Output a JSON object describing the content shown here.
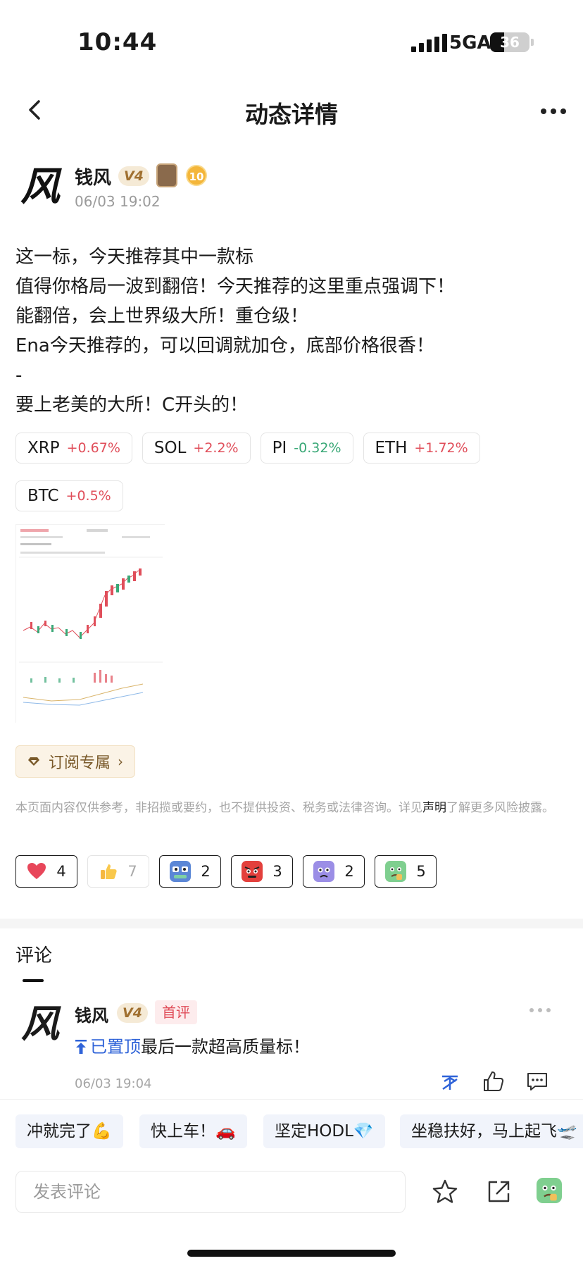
{
  "status_bar": {
    "time": "10:44",
    "network": "5GA",
    "battery": "36"
  },
  "nav": {
    "title": "动态详情",
    "back_icon": "chevron-left-icon",
    "more_icon": "more-icon"
  },
  "author": {
    "avatar_char": "风",
    "name": "钱风",
    "level_badge": "V4",
    "rank_badge": "10",
    "time": "06/03 19:02"
  },
  "post": {
    "lines": [
      "这一标，今天推荐其中一款标",
      "值得你格局一波到翻倍！今天推荐的这里重点强调下！",
      "能翻倍，会上世界级大所！重仓级！",
      "Ena今天推荐的，可以回调就加仓，底部价格很香！",
      "-",
      "要上老美的大所！C开头的！"
    ]
  },
  "tickers": [
    {
      "symbol": "XRP",
      "change": "+0.67%",
      "direction": "up"
    },
    {
      "symbol": "SOL",
      "change": "+2.2%",
      "direction": "up"
    },
    {
      "symbol": "PI",
      "change": "-0.32%",
      "direction": "down"
    },
    {
      "symbol": "ETH",
      "change": "+1.72%",
      "direction": "up"
    },
    {
      "symbol": "BTC",
      "change": "+0.5%",
      "direction": "up"
    }
  ],
  "subscribe": {
    "label": "订阅专属"
  },
  "disclaimer": {
    "before": "本页面内容仅供参考，非招揽或要约，也不提供投资、税务或法律咨询。详见",
    "link": "声明",
    "after": "了解更多风险披露。"
  },
  "reactions": [
    {
      "icon": "heart-icon",
      "count": "4",
      "active": true
    },
    {
      "icon": "thumbs-up-icon",
      "count": "7",
      "active": false
    },
    {
      "icon": "hodl-emoji-icon",
      "count": "2",
      "active": true
    },
    {
      "icon": "angry-emoji-icon",
      "count": "3",
      "active": true
    },
    {
      "icon": "cry-emoji-icon",
      "count": "2",
      "active": true
    },
    {
      "icon": "sick-emoji-icon",
      "count": "5",
      "active": true
    }
  ],
  "comments": {
    "label": "评论",
    "items": [
      {
        "avatar_char": "风",
        "name": "钱风",
        "level_badge": "V4",
        "tag": "首评",
        "pinned_label": "已置顶",
        "text": "最后一款超高质量标！",
        "time": "06/03 19:04"
      }
    ]
  },
  "quick_replies": [
    "冲就完了💪",
    "快上车！🚗",
    "坚定HODL💎",
    "坐稳扶好，马上起飞🛫"
  ],
  "input": {
    "placeholder": "发表评论"
  },
  "colors": {
    "up": "#e04e5a",
    "down": "#3aa877",
    "accent_gold": "#a07030",
    "pinned_blue": "#2f63d8"
  }
}
